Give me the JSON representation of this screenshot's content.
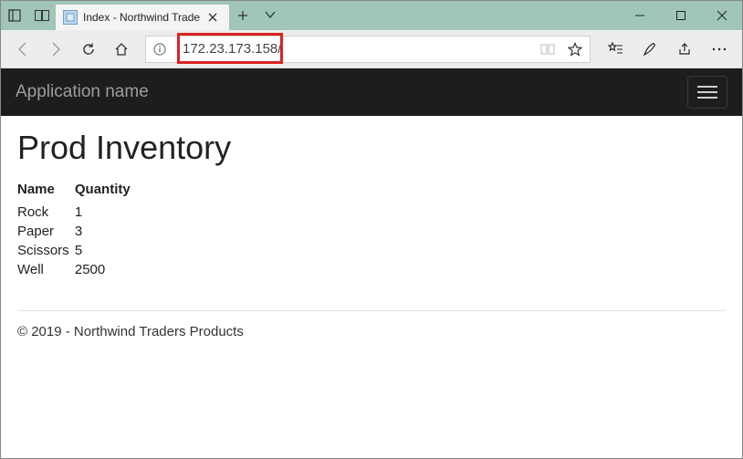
{
  "window": {
    "tab_title": "Index - Northwind Traders",
    "address": "172.23.173.158/"
  },
  "navbar": {
    "brand": "Application name"
  },
  "page": {
    "heading": "Prod Inventory",
    "columns": {
      "name": "Name",
      "quantity": "Quantity"
    },
    "rows": [
      {
        "name": "Rock",
        "quantity": "1"
      },
      {
        "name": "Paper",
        "quantity": "3"
      },
      {
        "name": "Scissors",
        "quantity": "5"
      },
      {
        "name": "Well",
        "quantity": "2500"
      }
    ],
    "footer": "© 2019 - Northwind Traders Products"
  }
}
